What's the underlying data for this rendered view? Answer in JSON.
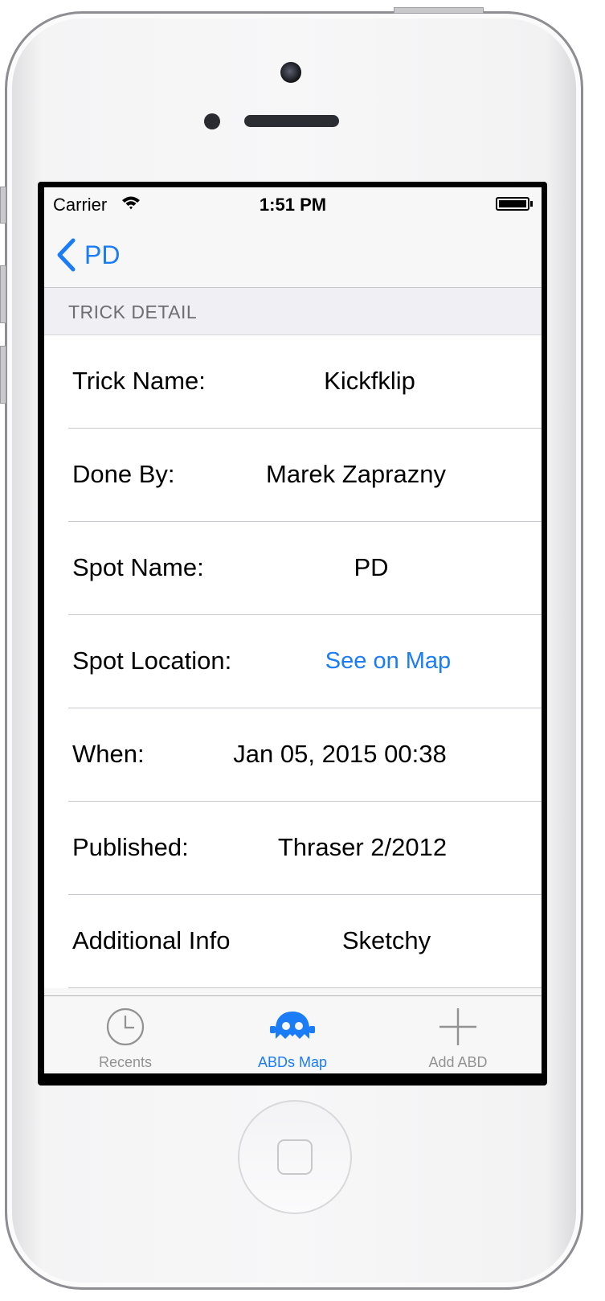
{
  "status_bar": {
    "carrier": "Carrier",
    "time": "1:51 PM"
  },
  "nav": {
    "back_label": "PD"
  },
  "section": {
    "header": "TRICK DETAIL"
  },
  "details": [
    {
      "label": "Trick Name:",
      "value": "Kickfklip"
    },
    {
      "label": "Done By:",
      "value": "Marek Zaprazny"
    },
    {
      "label": "Spot Name:",
      "value": "PD"
    },
    {
      "label": "Spot Location:",
      "value": "See on Map"
    },
    {
      "label": "When:",
      "value": "Jan 05, 2015 00:38"
    },
    {
      "label": "Published:",
      "value": "Thraser 2/2012"
    },
    {
      "label": "Additional Info",
      "value": "Sketchy"
    }
  ],
  "tabs": [
    {
      "label": "Recents",
      "icon": "clock-icon",
      "active": false
    },
    {
      "label": "ABDs Map",
      "icon": "ghost-icon",
      "active": true
    },
    {
      "label": "Add ABD",
      "icon": "plus-icon",
      "active": false
    }
  ],
  "colors": {
    "accent": "#1a7cf6",
    "tab_inactive": "#929292",
    "section_bg": "#efeff4"
  }
}
